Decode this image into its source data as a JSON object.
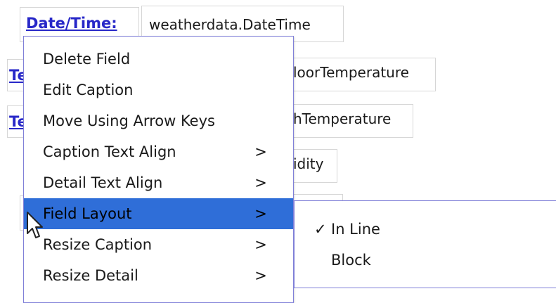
{
  "form": {
    "datetime_caption": "Date/Time:",
    "datetime_field": "weatherdata.DateTime",
    "row2_caption": "Te",
    "row2_field": "loorTemperature",
    "row3_caption": "Te",
    "row3_field": "hTemperature",
    "row4_field": "idity"
  },
  "context_menu": {
    "items": [
      {
        "label": "Delete Field",
        "arrow": ""
      },
      {
        "label": "Edit Caption",
        "arrow": ""
      },
      {
        "label": "Move Using Arrow Keys",
        "arrow": ""
      },
      {
        "label": "Caption Text Align",
        "arrow": ">"
      },
      {
        "label": "Detail Text Align",
        "arrow": ">"
      },
      {
        "label": "Field Layout",
        "arrow": ">"
      },
      {
        "label": "Resize Caption",
        "arrow": ">"
      },
      {
        "label": "Resize Detail",
        "arrow": ">"
      }
    ],
    "selected_index": 5,
    "highlight_color": "#2f6ed8"
  },
  "submenu": {
    "items": [
      {
        "check": "✓",
        "label": "In Line"
      },
      {
        "check": "",
        "label": "Block"
      }
    ]
  }
}
